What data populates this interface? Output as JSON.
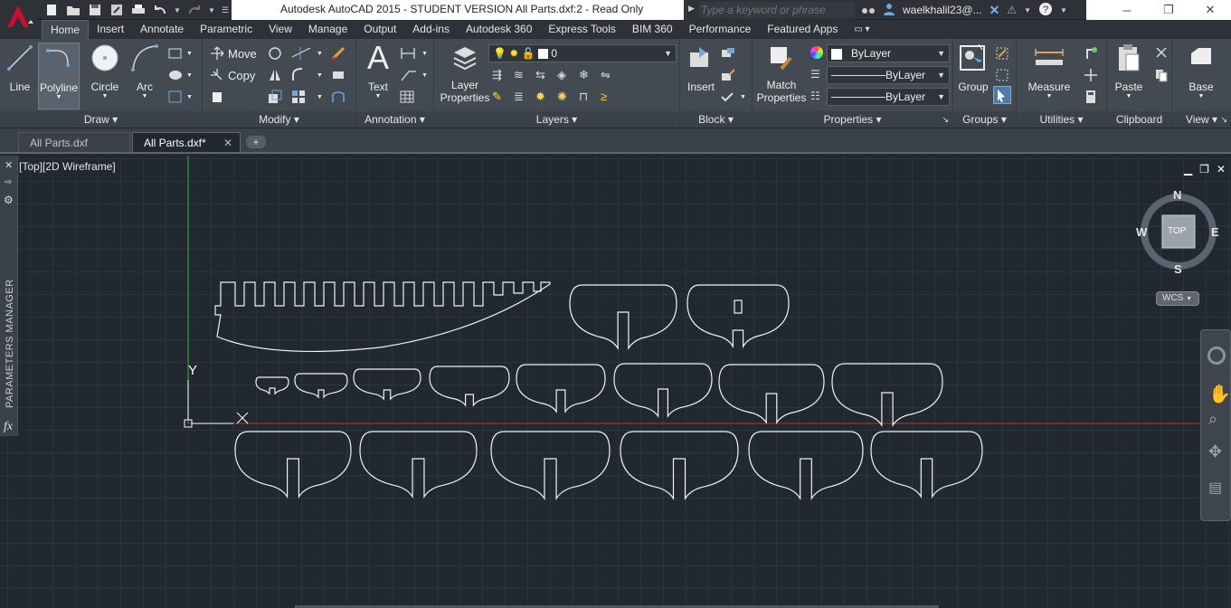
{
  "title_bar": {
    "app_title": "Autodesk AutoCAD 2015 - STUDENT VERSION    All Parts.dxf:2 - Read Only",
    "search_placeholder": "Type a keyword or phrase",
    "user_name": "waelkhalil23@..."
  },
  "ribbon_tabs": [
    "Home",
    "Insert",
    "Annotate",
    "Parametric",
    "View",
    "Manage",
    "Output",
    "Add-ins",
    "Autodesk 360",
    "Express Tools",
    "BIM 360",
    "Performance",
    "Featured Apps"
  ],
  "active_tab": "Home",
  "draw_panel": {
    "title": "Draw",
    "tools": [
      "Line",
      "Polyline",
      "Circle",
      "Arc"
    ]
  },
  "modify_panel": {
    "title": "Modify",
    "move": "Move",
    "copy": "Copy"
  },
  "annotation_panel": {
    "title": "Annotation",
    "text": "Text"
  },
  "layers_panel": {
    "title": "Layers",
    "layer_properties": "Layer\nProperties",
    "current_layer": "0"
  },
  "block_panel": {
    "title": "Block",
    "insert": "Insert"
  },
  "properties_panel": {
    "title": "Properties",
    "match_properties": "Match\nProperties",
    "color": "ByLayer",
    "linetype": "ByLayer",
    "lineweight": "ByLayer"
  },
  "groups_panel": {
    "title": "Groups",
    "group": "Group"
  },
  "utilities_panel": {
    "title": "Utilities",
    "measure": "Measure"
  },
  "clipboard_panel": {
    "title": "Clipboard",
    "paste": "Paste"
  },
  "view_panel": {
    "title": "View",
    "base": "Base"
  },
  "doc_tabs": {
    "tab1": "All Parts.dxf",
    "tab2": "All Parts.dxf*",
    "close": "✕",
    "new": "+"
  },
  "viewport": {
    "label": "[Top][2D Wireframe]",
    "params_manager": "PARAMETERS MANAGER",
    "ucs_x": "X",
    "ucs_y": "Y"
  },
  "viewcube": {
    "n": "N",
    "s": "S",
    "e": "E",
    "w": "W",
    "face": "TOP",
    "wcs": "WCS"
  },
  "colors": {
    "canvas_bg": "#212830",
    "ribbon_bg": "#434a52",
    "accent_red": "#c8102e"
  }
}
